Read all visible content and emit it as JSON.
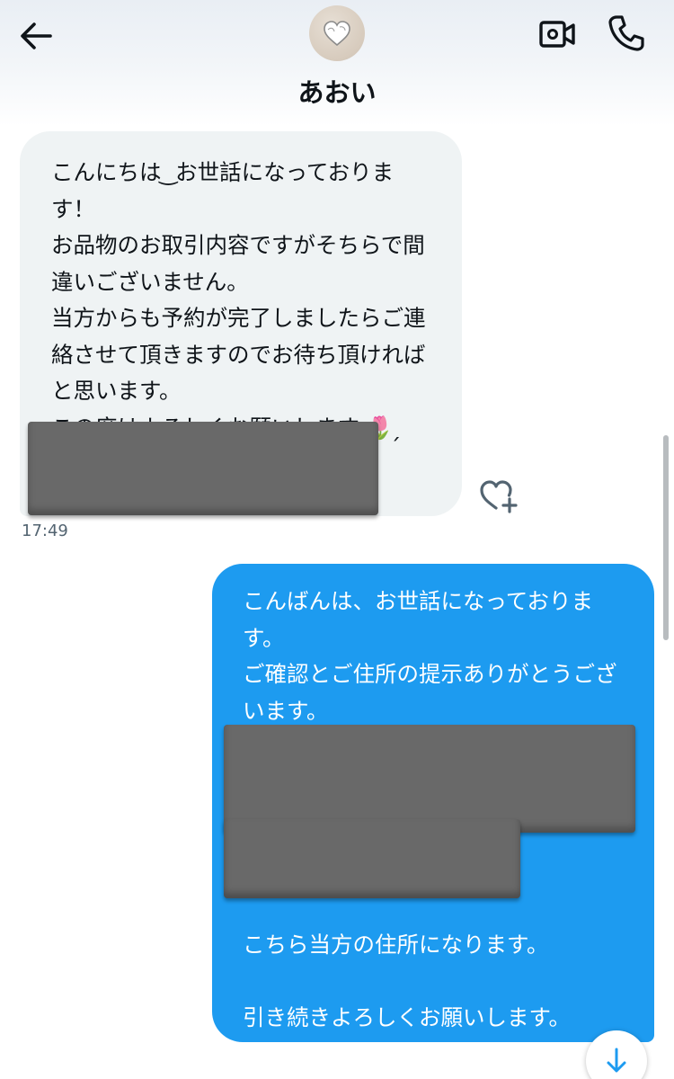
{
  "header": {
    "contact_name": "あおい",
    "icons": {
      "back": "arrow-left-icon",
      "avatar": "heart-avatar",
      "video_call": "video-camera-icon",
      "voice_call": "phone-icon"
    }
  },
  "messages": [
    {
      "direction": "incoming",
      "text": "こんにちは ͜ お世話になっておりま\nす！\nお品物のお取引内容ですがそちらで間\n違いございません。\n当方からも予約が完了しましたらご連\n絡させて頂きますのでお待ち頂ければ\nと思います。\nこの度はよろしくお願いします ̖🌷 ̗",
      "has_redacted_block": true,
      "time": "17:49"
    },
    {
      "direction": "outgoing",
      "text": "こんばんは、お世話になっておりま\nす。\nご確認とご住所の提示ありがとうござ\nいます。",
      "text_after": "こちら当方の住所になります。\n\n引き続きよろしくお願いします。",
      "redacted_blocks": 2
    }
  ],
  "actions": {
    "react_icon": "heart-plus-icon",
    "scroll_down_icon": "arrow-down-icon"
  },
  "colors": {
    "incoming_bubble": "#eff3f4",
    "outgoing_bubble": "#1d9bf0",
    "redaction": "#696969",
    "timestamp": "#536471"
  }
}
